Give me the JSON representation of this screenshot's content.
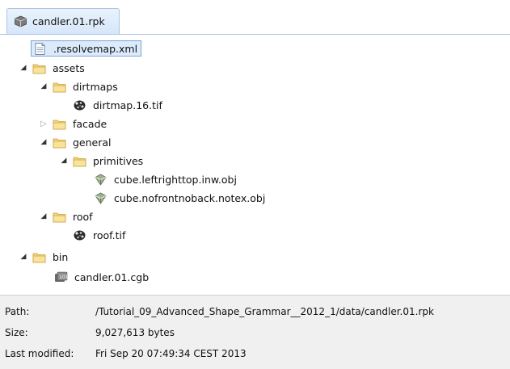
{
  "tab": {
    "title": "candler.01.rpk",
    "icon": "package-icon"
  },
  "tree": {
    "rows": [
      {
        "label": ".resolvemap.xml",
        "icon": "xml-file-icon",
        "toggle": "",
        "selected": true
      },
      {
        "label": "assets",
        "icon": "folder-icon",
        "toggle": "expanded"
      },
      {
        "label": "dirtmaps",
        "icon": "folder-icon",
        "toggle": "expanded"
      },
      {
        "label": "dirtmap.16.tif",
        "icon": "texture-file-icon",
        "toggle": ""
      },
      {
        "label": "facade",
        "icon": "folder-icon",
        "toggle": "collapsed"
      },
      {
        "label": "general",
        "icon": "folder-icon",
        "toggle": "expanded"
      },
      {
        "label": "primitives",
        "icon": "folder-icon",
        "toggle": "expanded"
      },
      {
        "label": "cube.leftrighttop.inw.obj",
        "icon": "obj-file-icon",
        "toggle": ""
      },
      {
        "label": "cube.nofrontnoback.notex.obj",
        "icon": "obj-file-icon",
        "toggle": ""
      },
      {
        "label": "roof",
        "icon": "folder-icon",
        "toggle": "expanded"
      },
      {
        "label": "roof.tif",
        "icon": "texture-file-icon",
        "toggle": ""
      },
      {
        "label": "bin",
        "icon": "folder-icon",
        "toggle": "expanded"
      },
      {
        "label": "candler.01.cgb",
        "icon": "cgb-file-icon",
        "toggle": ""
      }
    ]
  },
  "info": {
    "path_label": "Path:",
    "path_value": "/Tutorial_09_Advanced_Shape_Grammar__2012_1/data/candler.01.rpk",
    "size_label": "Size:",
    "size_value": "9,027,613 bytes",
    "modified_label": "Last modified:",
    "modified_value": "Fri Sep 20 07:49:34 CEST 2013"
  }
}
